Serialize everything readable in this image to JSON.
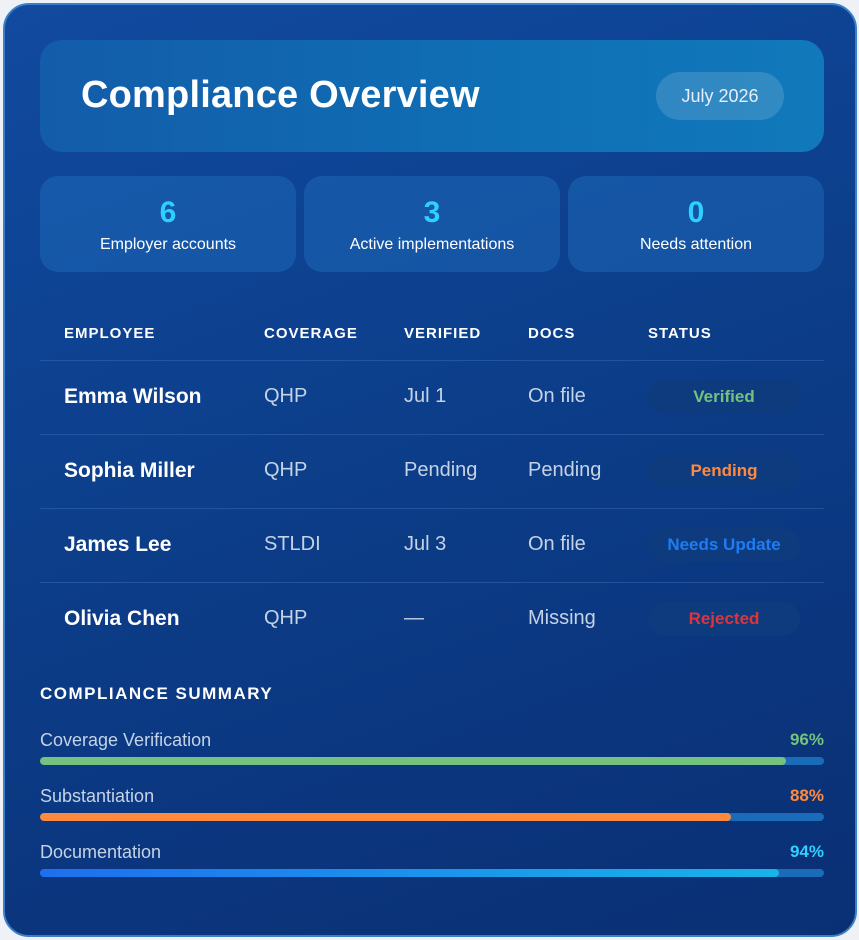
{
  "header": {
    "title": "Compliance Overview",
    "date": "July 2026"
  },
  "stats": [
    {
      "value": "6",
      "label": "Employer accounts"
    },
    {
      "value": "3",
      "label": "Active implementations"
    },
    {
      "value": "0",
      "label": "Needs attention"
    }
  ],
  "table": {
    "columns": [
      "EMPLOYEE",
      "COVERAGE",
      "VERIFIED",
      "DOCS",
      "STATUS"
    ],
    "rows": [
      {
        "employee": "Emma Wilson",
        "coverage": "QHP",
        "verified": "Jul 1",
        "docs": "On file",
        "status": "Verified"
      },
      {
        "employee": "Sophia Miller",
        "coverage": "QHP",
        "verified": "Pending",
        "docs": "Pending",
        "status": "Pending"
      },
      {
        "employee": "James Lee",
        "coverage": "STLDI",
        "verified": "Jul 3",
        "docs": "On file",
        "status": "Needs Update"
      },
      {
        "employee": "Olivia Chen",
        "coverage": "QHP",
        "verified": "—",
        "docs": "Missing",
        "status": "Rejected"
      }
    ]
  },
  "status_colors": {
    "Verified": "#74c27e",
    "Pending": "#ff8a3d",
    "Needs Update": "#1e7cf5",
    "Rejected": "#e0333a"
  },
  "summary": {
    "title": "COMPLIANCE SUMMARY",
    "metrics": [
      {
        "label": "Coverage Verification",
        "value": "96%",
        "fraction": 0.951,
        "color": "#74c27e"
      },
      {
        "label": "Substantiation",
        "value": "88%",
        "fraction": 0.882,
        "color": "#ff8a3d"
      },
      {
        "label": "Documentation",
        "value": "94%",
        "fraction": 0.942,
        "color": "#1e90f0"
      }
    ]
  }
}
